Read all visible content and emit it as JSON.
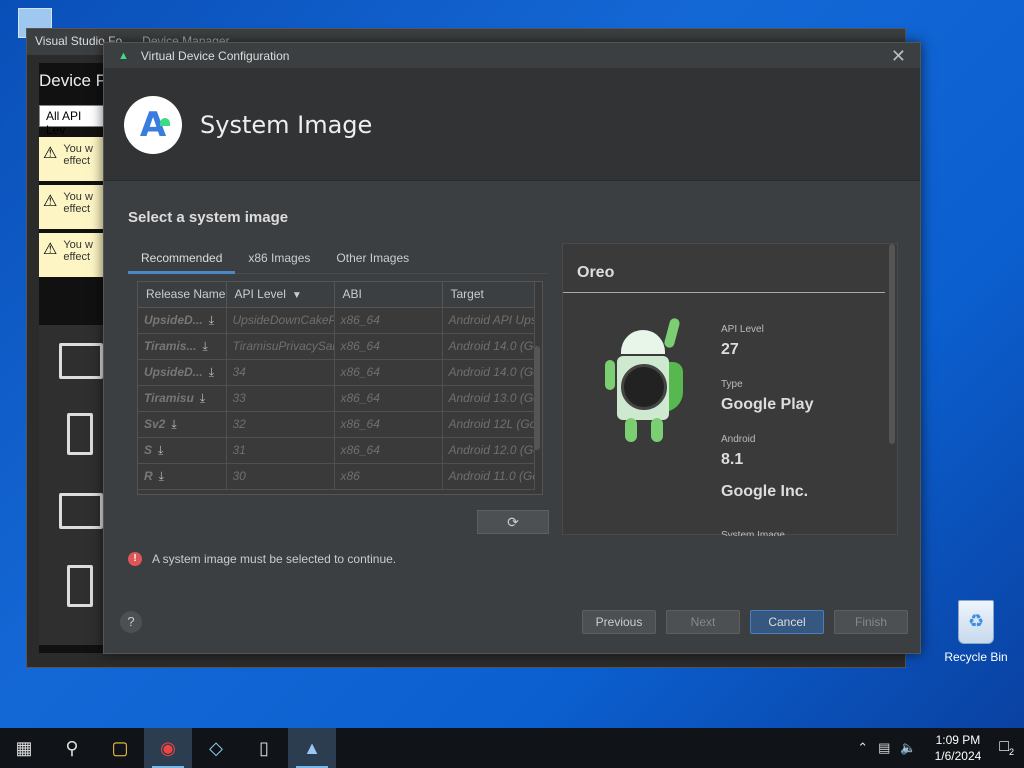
{
  "desktop": {
    "recycle_bin_label": "Recycle Bin"
  },
  "device_manager": {
    "title": "Visual Studio Fo",
    "title_extra": "Device Manager",
    "heading": "Device P",
    "api_filter": "All API Lev",
    "warnings": [
      {
        "line1": "You w",
        "line2": "effect"
      },
      {
        "line1": "You w",
        "line2": "effect"
      },
      {
        "line1": "You w",
        "line2": "effect"
      }
    ]
  },
  "dialog": {
    "title": "Virtual Device Configuration",
    "banner_title": "System Image",
    "section_title": "Select a system image",
    "tabs": [
      {
        "label": "Recommended",
        "active": true
      },
      {
        "label": "x86 Images",
        "active": false
      },
      {
        "label": "Other Images",
        "active": false
      }
    ],
    "table": {
      "columns": [
        "Release Name",
        "API Level",
        "ABI",
        "Target"
      ],
      "rows": [
        {
          "release": "UpsideD...",
          "api": "UpsideDownCakeP",
          "abi": "x86_64",
          "target": "Android API Ups"
        },
        {
          "release": "Tiramis...",
          "api": "TiramisuPrivacySan",
          "abi": "x86_64",
          "target": "Android 14.0 (Go"
        },
        {
          "release": "UpsideD...",
          "api": "34",
          "abi": "x86_64",
          "target": "Android 14.0 (Go"
        },
        {
          "release": "Tiramisu",
          "api": "33",
          "abi": "x86_64",
          "target": "Android 13.0 (Go"
        },
        {
          "release": "Sv2",
          "api": "32",
          "abi": "x86_64",
          "target": "Android 12L (Go"
        },
        {
          "release": "S",
          "api": "31",
          "abi": "x86_64",
          "target": "Android 12.0 (Go"
        },
        {
          "release": "R",
          "api": "30",
          "abi": "x86",
          "target": "Android 11.0 (Go"
        }
      ]
    },
    "error_message": "A system image must be selected to continue.",
    "detail": {
      "name": "Oreo",
      "api_level_label": "API Level",
      "api_level": "27",
      "type_label": "Type",
      "type": "Google Play",
      "android_label": "Android",
      "android_version": "8.1",
      "vendor": "Google Inc.",
      "system_image_label": "System Image"
    },
    "buttons": {
      "help": "?",
      "previous": "Previous",
      "next": "Next",
      "cancel": "Cancel",
      "finish": "Finish"
    }
  },
  "taskbar": {
    "time": "1:09 PM",
    "date": "1/6/2024",
    "notification_count": "2"
  }
}
